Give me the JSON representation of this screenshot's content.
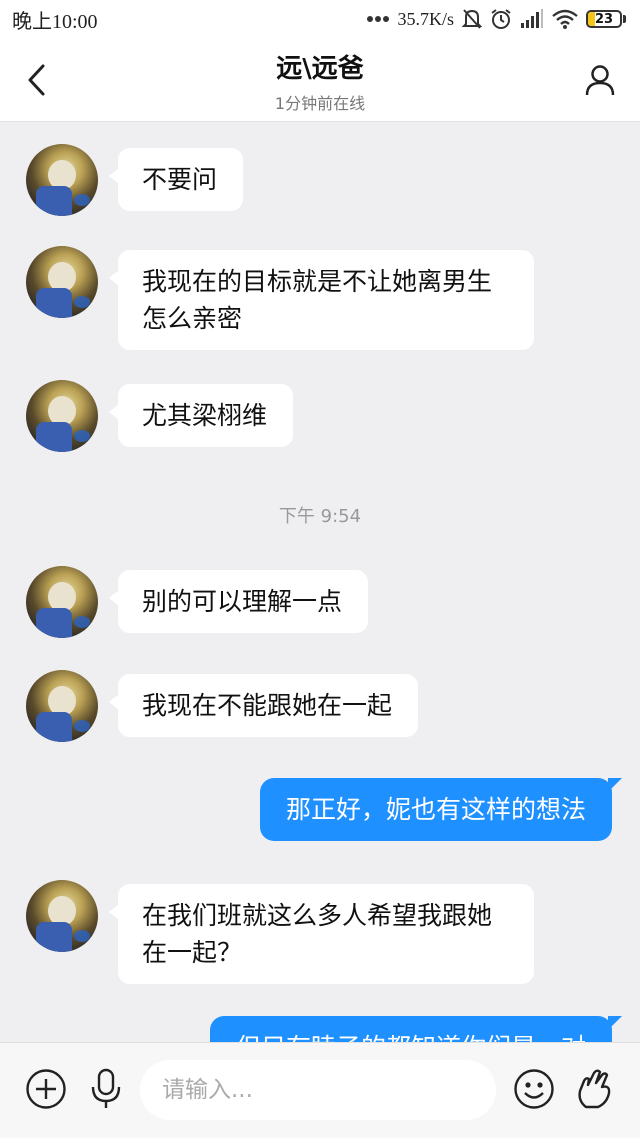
{
  "status_bar": {
    "time": "晚上10:00",
    "network_speed": "35.7K/s",
    "battery_level": "23",
    "battery_percent": 23,
    "icons": [
      "dots-icon",
      "mute-bell-icon",
      "alarm-icon",
      "signal-icon",
      "wifi-icon",
      "battery-icon"
    ]
  },
  "header": {
    "title": "远\\远爸",
    "subtitle": "1分钟前在线",
    "back_icon": "chevron-left-icon",
    "profile_icon": "person-icon"
  },
  "messages": [
    {
      "side": "left",
      "text": "不要问"
    },
    {
      "side": "left",
      "text": "我现在的目标就是不让她离男生怎么亲密"
    },
    {
      "side": "left",
      "text": "尤其梁栩维"
    },
    {
      "type": "time",
      "text": "下午 9:54"
    },
    {
      "side": "left",
      "text": "别的可以理解一点"
    },
    {
      "side": "left",
      "text": "我现在不能跟她在一起"
    },
    {
      "side": "right",
      "text": "那正好，妮也有这样的想法"
    },
    {
      "side": "left",
      "text": "在我们班就这么多人希望我跟她在一起？"
    },
    {
      "side": "right",
      "text": "但只有睦子的都知道你们是一对"
    }
  ],
  "input_bar": {
    "placeholder": "请输入...",
    "icons": [
      "plus-circle-icon",
      "microphone-icon",
      "emoji-icon",
      "hand-gesture-icon"
    ]
  },
  "colors": {
    "accent": "#1e90ff",
    "background": "#efeff2",
    "bubble_left": "#ffffff"
  }
}
